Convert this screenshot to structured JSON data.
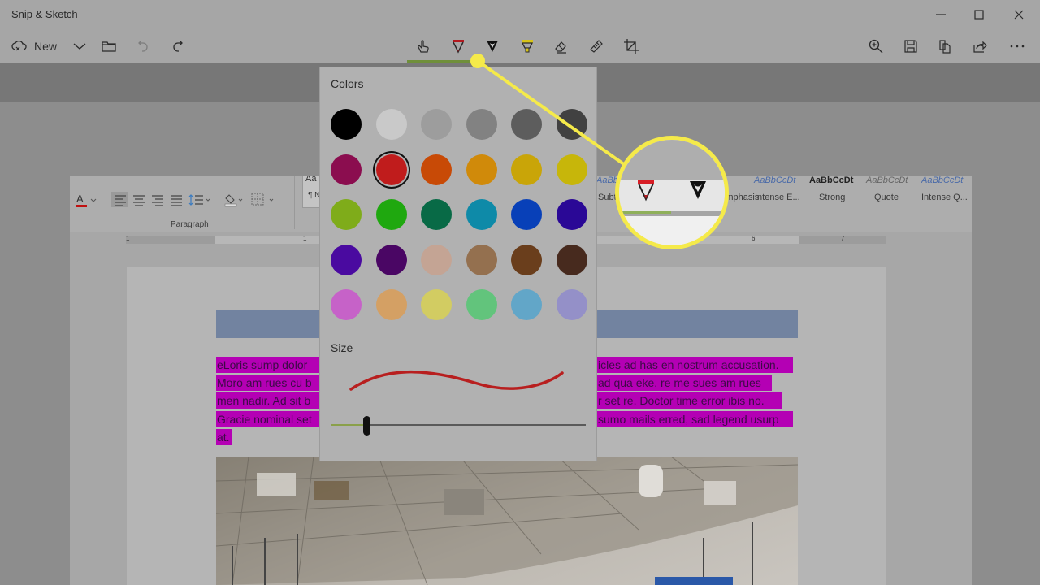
{
  "app": {
    "title": "Snip & Sketch",
    "window_controls": [
      "minimize",
      "maximize",
      "close"
    ]
  },
  "toolbar": {
    "new_label": "New",
    "left_icons": [
      "new-snip-icon",
      "chevron-down-icon",
      "folder-icon",
      "undo-icon",
      "redo-icon"
    ],
    "center_tools": [
      {
        "name": "touch-writing",
        "icon": "touch-writing-icon"
      },
      {
        "name": "ballpoint-pen",
        "icon": "ballpoint-pen-icon",
        "active": true,
        "color": "#b3191f"
      },
      {
        "name": "pencil",
        "icon": "pencil-icon"
      },
      {
        "name": "highlighter",
        "icon": "highlighter-icon"
      },
      {
        "name": "eraser",
        "icon": "eraser-icon"
      },
      {
        "name": "ruler",
        "icon": "ruler-icon"
      },
      {
        "name": "crop",
        "icon": "crop-icon"
      }
    ],
    "right_icons": [
      "zoom-in-icon",
      "save-icon",
      "copy-icon",
      "share-icon",
      "more-icon"
    ]
  },
  "color_panel": {
    "colors_label": "Colors",
    "size_label": "Size",
    "selected_color": "#c01c1c",
    "swatches": [
      [
        "#000000",
        "#c9c9c9",
        "#9d9d9d",
        "#828282",
        "#5d5d5d",
        "#414141"
      ],
      [
        "#8b0d4f",
        "#c01c1c",
        "#c84a06",
        "#d08a0a",
        "#c9a508",
        "#c7b60a"
      ],
      [
        "#7fac1a",
        "#1fa80f",
        "#086a46",
        "#0e8aa8",
        "#0840b8",
        "#2a0896"
      ],
      [
        "#4a0aa0",
        "#4a0664",
        "#c4a494",
        "#94704f",
        "#6a3e1c",
        "#472a1e"
      ],
      [
        "#c662c8",
        "#d4a064",
        "#d2cc62",
        "#62c47c",
        "#62a6c8",
        "#9490c8"
      ]
    ],
    "size_value_fraction": 0.14,
    "accent_color": "#8aa04a"
  },
  "document": {
    "ribbon": {
      "paragraph_label": "Paragraph",
      "style_samples": [
        "AaBbCcDt",
        "AaBbCcDt",
        "AaBbCcDt",
        "AaBbCcDt",
        "AaBbCcDt"
      ],
      "style_names": [
        "Subtitle",
        "Emphasis",
        "Intense E...",
        "Strong",
        "Quote",
        "Intense Q..."
      ],
      "partial_left": "¶ N",
      "partial_top": "Aa"
    },
    "ruler_numbers": [
      "1",
      "1",
      "6",
      "7"
    ],
    "highlighted_left": [
      "eLoris sump dolor",
      "Moro am rues cu b",
      "men nadir. Ad sit b",
      "Gracie nominal set",
      "at."
    ],
    "highlighted_right": [
      "icles ad has en nostrum accusation.",
      "ad qua eke, re me sues am rues",
      "r set re. Doctor time error ibis no.",
      "sumo mails erred, sad legend usurp"
    ]
  },
  "callout": {
    "color": "#f5ea4a",
    "magnified_tools": [
      "ballpoint-pen-icon",
      "pencil-icon"
    ]
  }
}
